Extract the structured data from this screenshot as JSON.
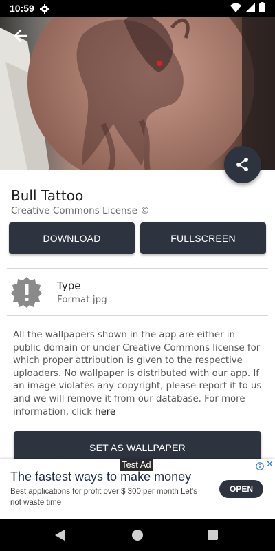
{
  "status_bar": {
    "time": "10:59"
  },
  "wallpaper": {
    "title": "Bull Tattoo",
    "license": "Creative Commons License ©"
  },
  "actions": {
    "download_label": "DOWNLOAD",
    "fullscreen_label": "FULLSCREEN",
    "set_wallpaper_label": "SET AS WALLPAPER"
  },
  "info": {
    "type_label": "Type",
    "type_value": "Format jpg"
  },
  "disclaimer": {
    "text": "All the wallpapers shown in the app are either in public domain or under Creative Commons license for which proper attribution is given to the respective uploaders. No wallpaper is distributed with our app. If an image violates any copyright, please report it to us and we will remove it from our database. For more information, click ",
    "link_text": "here"
  },
  "ad": {
    "tag": "Test Ad",
    "headline": "The fastest ways to make money",
    "body": "Best applications for profit over $ 300 per month Let's not waste time",
    "cta": "OPEN",
    "close": "✕"
  },
  "colors": {
    "primary_dark": "#2d3440",
    "divider": "#d6d6d6"
  }
}
